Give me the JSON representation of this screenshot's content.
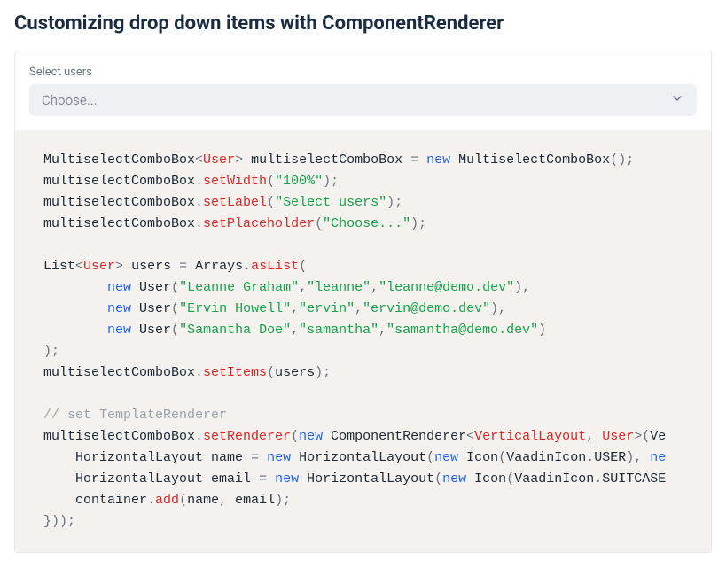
{
  "title": "Customizing drop down items with ComponentRenderer",
  "field": {
    "label": "Select users",
    "placeholder": "Choose...",
    "chevron_name": "chevron-down-icon"
  },
  "code": {
    "l1": {
      "cls": "MultiselectComboBox",
      "gen": "User",
      "var": " multiselectComboBox ",
      "kw": "new",
      "ctor": " MultiselectComboBox"
    },
    "l2": {
      "v": "multiselectComboBox",
      "m": "setWidth",
      "s": "\"100%\""
    },
    "l3": {
      "v": "multiselectComboBox",
      "m": "setLabel",
      "s": "\"Select users\""
    },
    "l4": {
      "v": "multiselectComboBox",
      "m": "setPlaceholder",
      "s": "\"Choose...\""
    },
    "l6": {
      "t": "List",
      "gen": "User",
      "var": " users ",
      "cls2": "Arrays",
      "m": "asList"
    },
    "l7": {
      "kw": "new",
      "ctor": " User",
      "s1": "\"Leanne Graham\"",
      "s2": "\"leanne\"",
      "s3": "\"leanne@demo.dev\""
    },
    "l8": {
      "kw": "new",
      "ctor": " User",
      "s1": "\"Ervin Howell\"",
      "s2": "\"ervin\"",
      "s3": "\"ervin@demo.dev\""
    },
    "l9": {
      "kw": "new",
      "ctor": " User",
      "s1": "\"Samantha Doe\"",
      "s2": "\"samantha\"",
      "s3": "\"samantha@demo.dev\""
    },
    "l11": {
      "v": "multiselectComboBox",
      "m": "setItems",
      "arg": "users"
    },
    "cmt": "// set TemplateRenderer",
    "l13": {
      "v": "multiselectComboBox",
      "m": "setRenderer",
      "kw": "new",
      "ctor": " ComponentRenderer",
      "g1": "VerticalLayout",
      "g2": " User",
      "tail": "Ve"
    },
    "l14": {
      "t": "HorizontalLayout name ",
      "kw": "new",
      "ctor": " HorizontalLayout",
      "kw2": "new",
      "ic": " Icon",
      "en": "VaadinIcon",
      "m": "USER",
      "tail": "ne"
    },
    "l15": {
      "t": "HorizontalLayout email ",
      "kw": "new",
      "ctor": " HorizontalLayout",
      "kw2": "new",
      "ic": " Icon",
      "en": "VaadinIcon",
      "m": "SUITCASE"
    },
    "l16": {
      "v": "container",
      "m": "add",
      "a1": "name",
      "a2": " email"
    },
    "l17": {
      "tail": "}));"
    }
  }
}
